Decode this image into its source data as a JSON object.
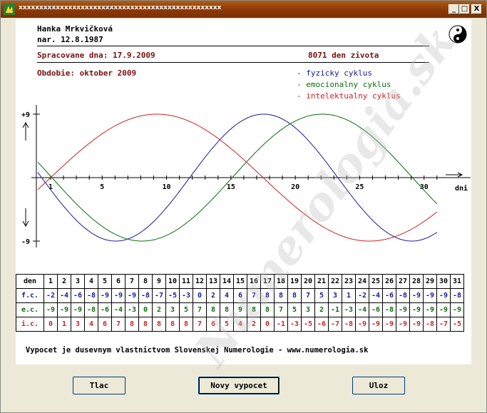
{
  "window": {
    "title": "xxxxxxxxxxxxxxxxxxxxxxxxxxxxxxxxxxxxxxxxxxxxxxxxx",
    "controls": {
      "minimize": "_",
      "maximize": "□",
      "close": "X"
    }
  },
  "header": {
    "name": "Hanka Mrkvičková",
    "born": "nar. 12.8.1987",
    "processed": "Spracovane dna: 17.9.2009",
    "days_lived": "8071 den zivota",
    "period": "Obdobie: oktober 2009"
  },
  "legend": [
    {
      "label": "- fyzicky cyklus",
      "color": "#1a1a9c"
    },
    {
      "label": "- emocionalny cyklus",
      "color": "#0a700a"
    },
    {
      "label": "- intelektualny cyklus",
      "color": "#d42020"
    }
  ],
  "chart_data": {
    "type": "line",
    "xlabel": "dni",
    "ytick_labels": [
      "+9",
      "-9"
    ],
    "xticks": [
      1,
      5,
      10,
      15,
      20,
      25,
      30
    ],
    "xlim": [
      0,
      31
    ],
    "ylim": [
      -9,
      9
    ],
    "series": [
      {
        "name": "fyzicky cyklus",
        "color": "#1a1a9c",
        "period": 23,
        "phase_day": 0.3
      },
      {
        "name": "emocionalny cyklus",
        "color": "#0a700a",
        "period": 28,
        "phase_day": 1.1
      },
      {
        "name": "intelektualny cyklus",
        "color": "#d42020",
        "period": 33,
        "phase_day": 1.0
      }
    ]
  },
  "table": {
    "header_label": "den",
    "days": [
      1,
      2,
      3,
      4,
      5,
      6,
      7,
      8,
      9,
      10,
      11,
      12,
      13,
      14,
      15,
      16,
      17,
      18,
      19,
      20,
      21,
      22,
      23,
      24,
      25,
      26,
      27,
      28,
      29,
      30,
      31
    ],
    "rows": [
      {
        "label": "f.c.",
        "color": "#1a1a9c",
        "values": [
          -2,
          -4,
          -6,
          -8,
          -9,
          -9,
          -9,
          -8,
          -7,
          -5,
          -3,
          0,
          2,
          4,
          6,
          7,
          8,
          8,
          8,
          7,
          5,
          3,
          1,
          -2,
          -4,
          -6,
          -8,
          -9,
          -9,
          -9,
          -8
        ]
      },
      {
        "label": "e.c.",
        "color": "#0a700a",
        "values": [
          -9,
          -9,
          -9,
          -8,
          -6,
          -4,
          -3,
          0,
          2,
          3,
          5,
          7,
          8,
          8,
          9,
          8,
          8,
          7,
          5,
          3,
          2,
          -1,
          -3,
          -4,
          -6,
          -8,
          -9,
          -9,
          -9,
          -9,
          -9
        ]
      },
      {
        "label": "i.c.",
        "color": "#d42020",
        "values": [
          0,
          1,
          3,
          4,
          6,
          7,
          8,
          8,
          8,
          8,
          8,
          7,
          6,
          5,
          4,
          2,
          0,
          -1,
          -3,
          -5,
          -6,
          -7,
          -8,
          -9,
          -9,
          -9,
          -9,
          -9,
          -8,
          -7,
          -5
        ]
      }
    ]
  },
  "footer": "Vypocet je dusevnym vlastnictvom Slovenskej Numerologie - www.numerologia.sk",
  "buttons": {
    "print": "Tlac",
    "new_calc": "Novy vypocet",
    "save": "Uloz"
  },
  "watermark": "Numerologia.sk"
}
